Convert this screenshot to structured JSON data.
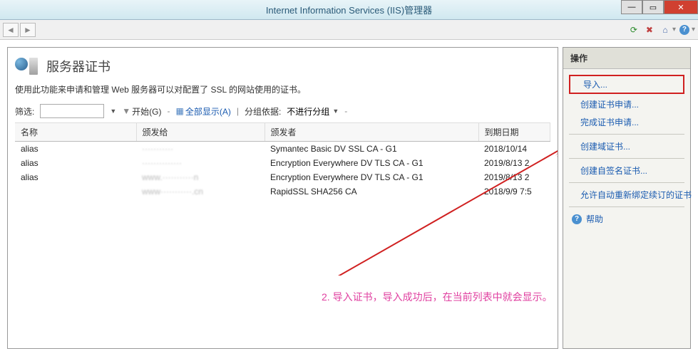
{
  "window": {
    "title": "Internet Information Services (IIS)管理器"
  },
  "page": {
    "title": "服务器证书",
    "description": "使用此功能来申请和管理 Web 服务器可以对配置了 SSL 的网站使用的证书。"
  },
  "filter": {
    "label": "筛选:",
    "start": "开始(G)",
    "show_all": "全部显示(A)",
    "group_label": "分组依据:",
    "group_value": "不进行分组"
  },
  "table": {
    "headers": {
      "name": "名称",
      "issued_to": "颁发给",
      "issued_by": "颁发者",
      "expiry": "到期日期"
    },
    "rows": [
      {
        "name": "alias",
        "issued_to": "···········",
        "issued_by": "Symantec Basic DV SSL CA - G1",
        "expiry": "2018/10/14"
      },
      {
        "name": "alias",
        "issued_to": "··············",
        "issued_by": "Encryption Everywhere DV TLS CA - G1",
        "expiry": "2019/8/13 2"
      },
      {
        "name": "alias",
        "issued_to": "www.···········n",
        "issued_by": "Encryption Everywhere DV TLS CA - G1",
        "expiry": "2019/8/13 2"
      },
      {
        "name": "",
        "issued_to": "www···········.cn",
        "issued_by": "RapidSSL SHA256 CA",
        "expiry": "2018/9/9 7:5"
      }
    ]
  },
  "actions": {
    "header": "操作",
    "import": "导入...",
    "create_request": "创建证书申请...",
    "complete_request": "完成证书申请...",
    "create_domain": "创建域证书...",
    "create_selfsigned": "创建自签名证书...",
    "allow_rebind": "允许自动重新绑定续订的证书",
    "help": "帮助"
  },
  "annotation": {
    "text": "2. 导入证书，导入成功后，在当前列表中就会显示。"
  }
}
